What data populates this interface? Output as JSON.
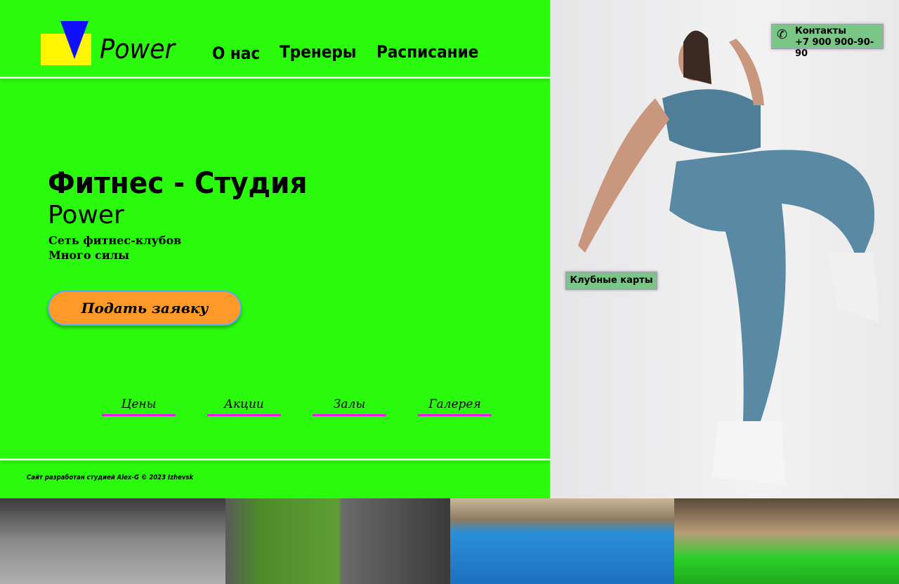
{
  "header": {
    "logo_text": "Power",
    "nav": [
      "О нас",
      "Тренеры",
      "Расписание"
    ]
  },
  "hero": {
    "title": "Фитнес - Студия",
    "subtitle": "Power",
    "tagline1": "Сеть фитнес-клубов",
    "tagline2": "Много силы",
    "cta": "Подать заявку"
  },
  "sections": [
    "Цены",
    "Акции",
    "Залы",
    "Галерея"
  ],
  "footer": {
    "text": "Сайт разработан студией Alex-G ©   2023 Izhevsk"
  },
  "contacts": {
    "label": "Контакты",
    "phone": "+7 900 900-90-90",
    "icon": "phone-icon"
  },
  "club_cards": "Клубные карты",
  "colors": {
    "bg": "#2afa0c",
    "accent": "#ff9a28",
    "underline": "#f01aef"
  }
}
